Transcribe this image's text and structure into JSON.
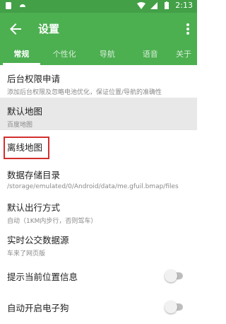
{
  "status_bar": {
    "time": "2:13"
  },
  "toolbar": {
    "title": "设置"
  },
  "tabs": [
    {
      "label": "常规",
      "active": true
    },
    {
      "label": "个性化",
      "active": false
    },
    {
      "label": "导航",
      "active": false
    },
    {
      "label": "语音",
      "active": false
    },
    {
      "label": "关于",
      "active": false
    }
  ],
  "settings": {
    "background_permission": {
      "title": "后台权限申请",
      "subtitle": "添加后台权限及忽略电池优化，保证位置/导航的准确性"
    },
    "default_map": {
      "title": "默认地图",
      "subtitle": "百度地图"
    },
    "offline_map": {
      "title": "离线地图"
    },
    "data_storage": {
      "title": "数据存储目录",
      "subtitle": "/storage/emulated/0/Android/data/me.gfuil.bmap/files"
    },
    "default_travel": {
      "title": "默认出行方式",
      "subtitle": "自动（1KM内步行，否则驾车）"
    },
    "bus_source": {
      "title": "实时公交数据源",
      "subtitle": "车来了网页版"
    },
    "show_location": {
      "title": "提示当前位置信息",
      "enabled": false
    },
    "auto_dog": {
      "title": "自动开启电子狗",
      "enabled": false
    }
  },
  "colors": {
    "primary": "#4caf50",
    "status_bar": "#43a047",
    "highlight": "#e8e8e8",
    "callout": "#d32f2f"
  }
}
